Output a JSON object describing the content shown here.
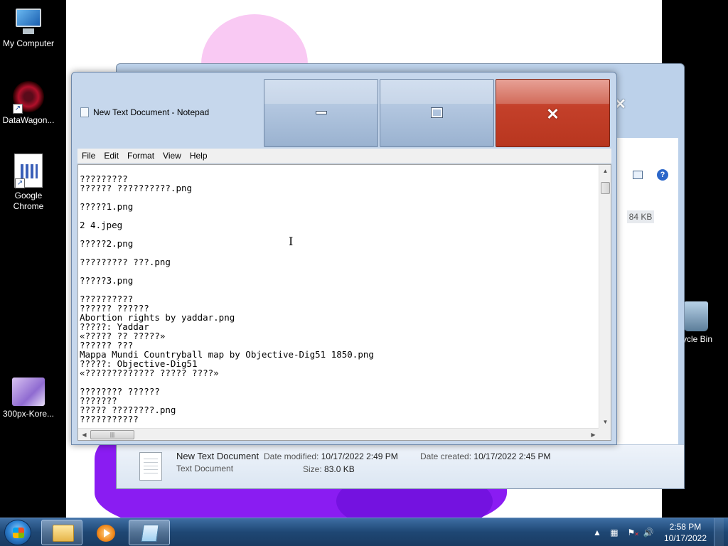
{
  "desktop": {
    "icons": [
      {
        "label": "My Computer"
      },
      {
        "label": "DataWagon..."
      },
      {
        "label": "Google Chrome"
      },
      {
        "label": "300px-Kore..."
      },
      {
        "label": "ycle Bin"
      }
    ]
  },
  "explorer": {
    "size_cell": "84 KB",
    "details": {
      "name": "New Text Document",
      "type": "Text Document",
      "date_modified_label": "Date modified:",
      "date_modified": "10/17/2022 2:49 PM",
      "date_created_label": "Date created:",
      "date_created": "10/17/2022 2:45 PM",
      "size_label": "Size:",
      "size": "83.0 KB"
    }
  },
  "notepad": {
    "title": "New Text Document - Notepad",
    "menu": [
      "File",
      "Edit",
      "Format",
      "View",
      "Help"
    ],
    "content_lines": [
      "?????????",
      "?????? ??????????.png",
      "",
      "?????1.png",
      "",
      "2 4.jpeg",
      "",
      "?????2.png",
      "",
      "????????? ???.png",
      "",
      "?????3.png",
      "",
      "??????????",
      "?????? ??????",
      "Abortion rights by yaddar.png",
      "?????: Yaddar",
      "«????? ?? ?????»",
      "?????? ???",
      "Mappa Mundi Countryball map by Objective-Dig51 1850.png",
      "?????: Objective-Dig51",
      "«????????????? ????? ????»",
      "",
      "???????? ??????",
      "???????",
      "????? ????????.png",
      "???????????"
    ]
  },
  "taskbar": {
    "time": "2:58 PM",
    "date": "10/17/2022"
  }
}
